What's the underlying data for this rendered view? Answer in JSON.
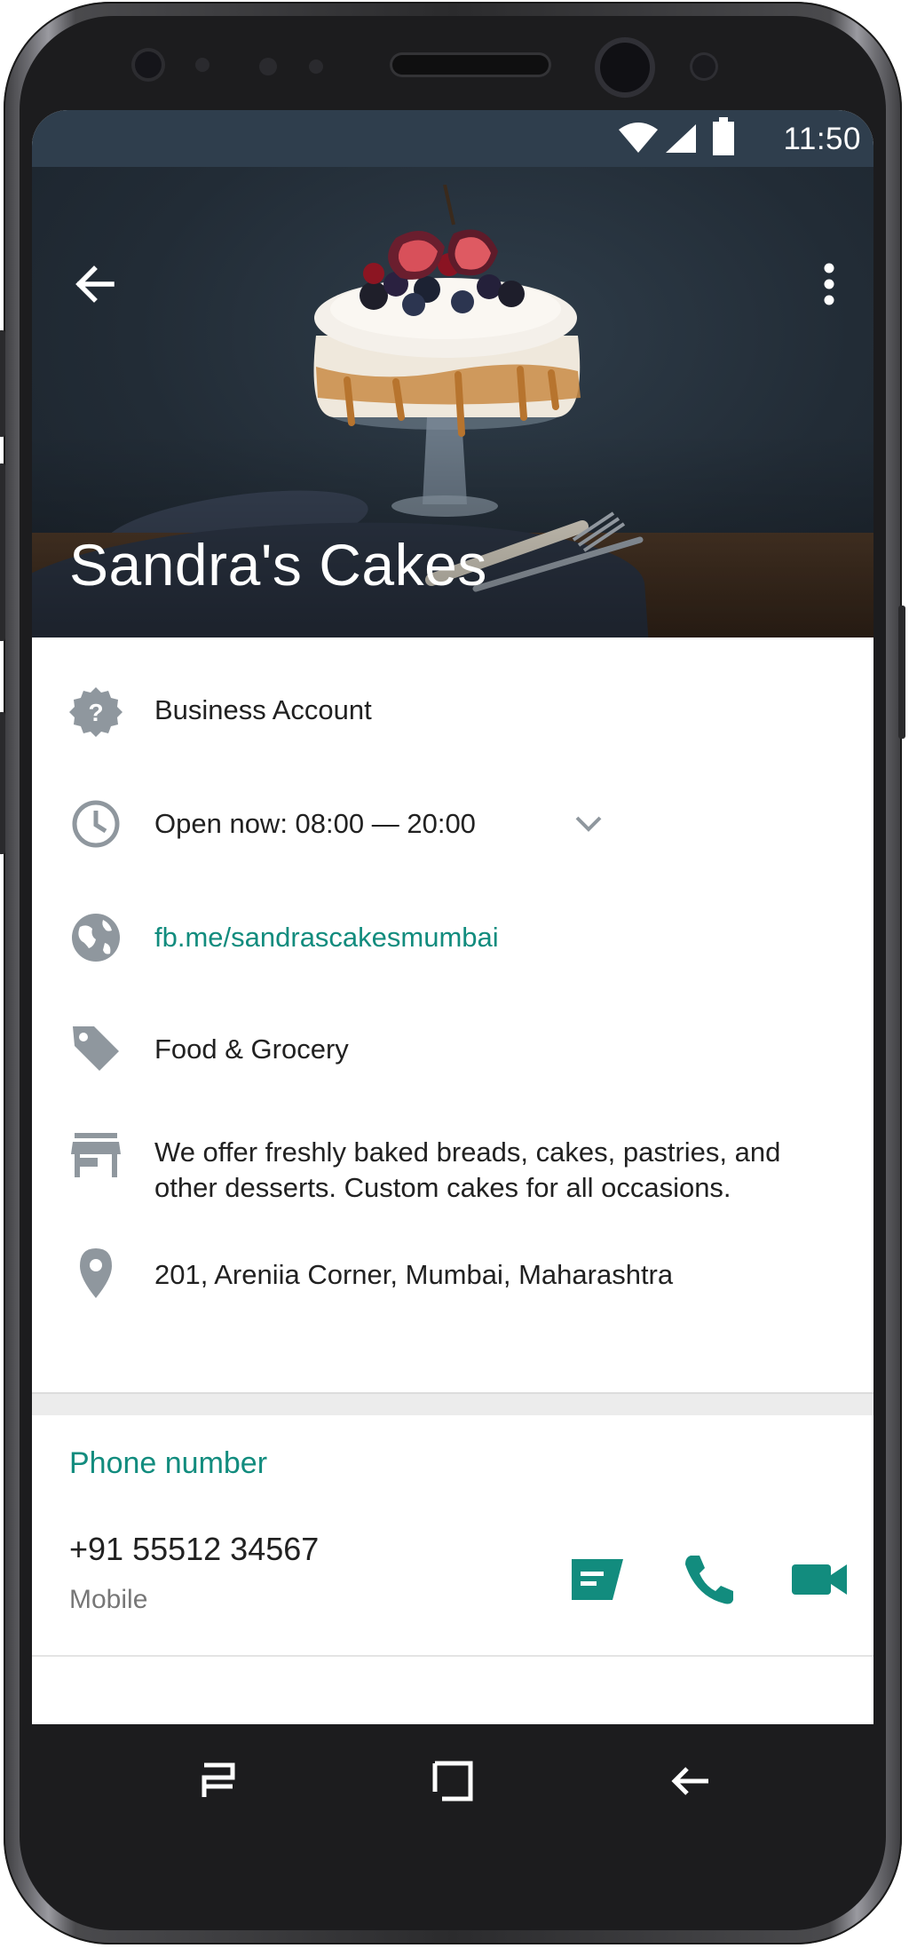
{
  "status_bar": {
    "time": "11:50",
    "icons": [
      "wifi-icon",
      "signal-icon",
      "battery-icon"
    ]
  },
  "header": {
    "title": "Sandra's Cakes",
    "back_icon": "arrow-left-icon",
    "menu_icon": "more-vertical-icon"
  },
  "info": {
    "account_type": "Business Account",
    "hours": "Open now: 08:00 — 20:00",
    "website": "fb.me/sandrascakesmumbai",
    "category": "Food & Grocery",
    "description_line1": "We offer freshly baked breads, cakes, pastries, and",
    "description_line2": "other desserts. Custom cakes for all occasions.",
    "address": "201, Areniia Corner, Mumbai, Maharashtra"
  },
  "phone_section": {
    "title": "Phone number",
    "number": "+91 55512 34567",
    "type": "Mobile",
    "actions": [
      "message-icon",
      "call-icon",
      "video-call-icon"
    ]
  },
  "navigation": {
    "buttons": [
      "recent-apps-icon",
      "home-icon",
      "back-icon"
    ]
  },
  "colors": {
    "accent": "#128c7e",
    "status_bar": "#2f3e4d",
    "icon_gray": "#8f979e"
  }
}
